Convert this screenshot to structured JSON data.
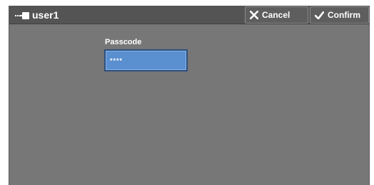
{
  "header": {
    "title": "user1",
    "icon": "key-icon",
    "cancel_label": "Cancel",
    "confirm_label": "Confirm"
  },
  "form": {
    "passcode_label": "Passcode",
    "passcode_value": "****"
  },
  "colors": {
    "background": "#777777",
    "titlebar": "#545454",
    "field_fill": "#5a8fd0",
    "field_border": "#2b4f7e"
  }
}
